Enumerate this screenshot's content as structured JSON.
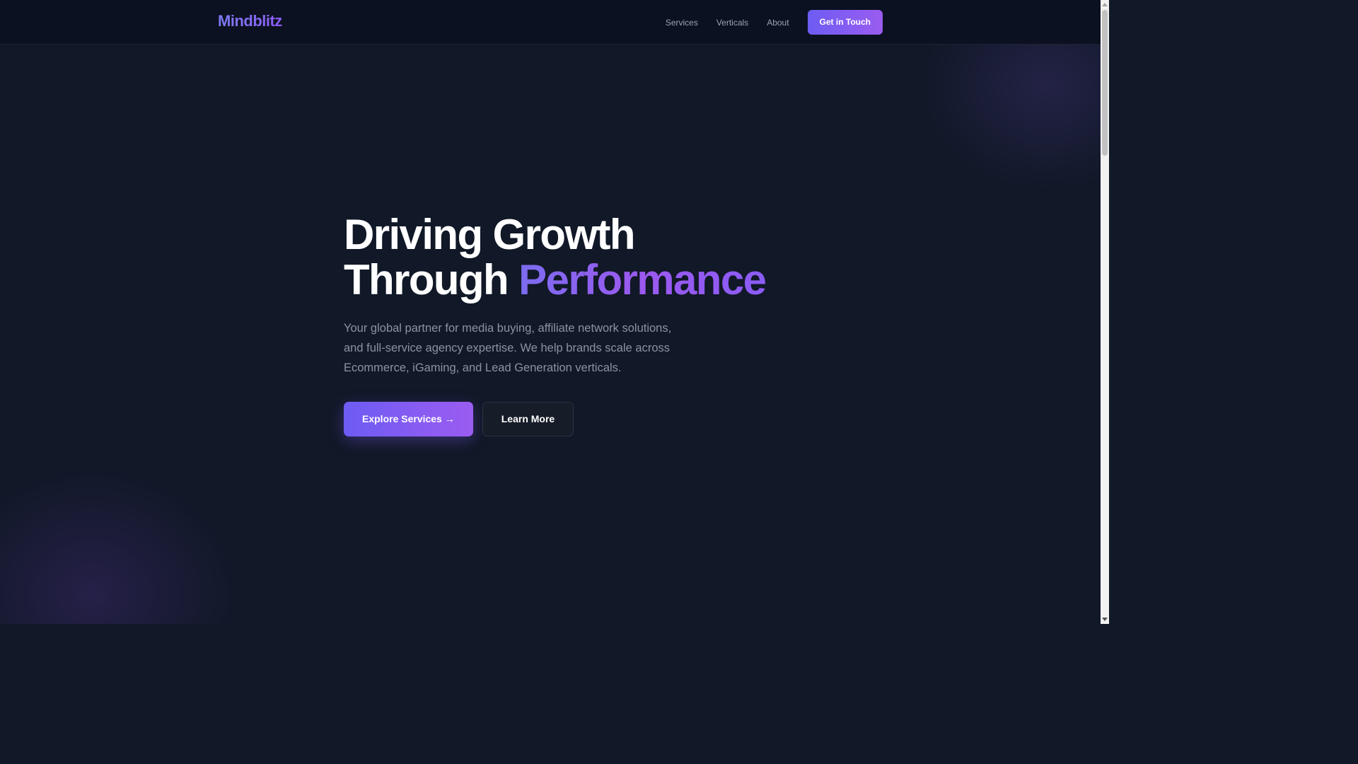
{
  "brand": {
    "name": "Mindblitz"
  },
  "nav": {
    "links": [
      "Services",
      "Verticals",
      "About"
    ],
    "cta_label": "Get in Touch"
  },
  "hero": {
    "title_line1": "Driving Growth",
    "title_line2_prefix": "Through",
    "title_line2_accent": "Performance",
    "subtitle": "Your global partner for media buying, affiliate network solutions, and full-service agency expertise. We help brands scale across Ecommerce, iGaming, and Lead Generation verticals.",
    "primary_button": "Explore Services →",
    "secondary_button": "Learn More"
  },
  "colors": {
    "background": "#111827",
    "navbar": "#0b1120",
    "accent_start": "#6d5cf3",
    "accent_end": "#9b5cf1",
    "muted_text": "#8b93a2"
  },
  "icons": {
    "scroll_up": "triangle-up",
    "scroll_down": "triangle-down"
  }
}
